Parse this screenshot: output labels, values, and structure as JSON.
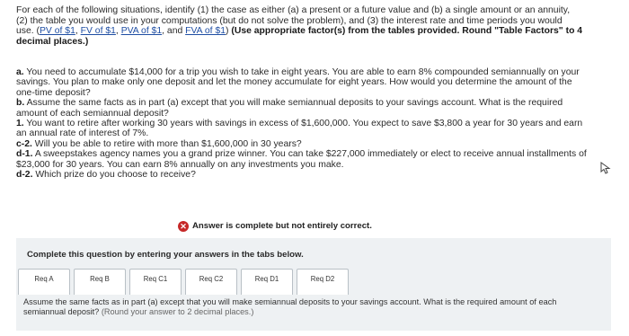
{
  "intro": {
    "line1": "For each of the following situations, identify (1) the case as either (a) a present or a future value and (b) a single amount or an annuity,",
    "line2": "(2) the table you would use in your computations (but do not solve the problem), and (3) the interest rate and time periods you would",
    "use": "use.",
    "link_pv": "PV of $1",
    "link_fv": "FV of $1",
    "link_pva": "PVA of $1",
    "link_fva": "FVA of $1",
    "comma": ", ",
    "and": ", and ",
    "paren_open": "(",
    "paren_close": ")",
    "bold_instruction": "(Use appropriate factor(s) from the tables provided. Round \"Table Factors\" to 4",
    "bold_instruction2": "decimal places.)"
  },
  "questions": [
    {
      "label": "a.",
      "text": "You need to accumulate $14,000 for a trip you wish to take in eight years. You are able to earn 8% compounded semiannually on your savings. You plan to make only one deposit and let the money accumulate for eight years. How would you determine the amount of the one-time deposit?"
    },
    {
      "label": "b.",
      "text": "Assume the same facts as in part (a) except that you will make semiannual deposits to your savings account. What is the required amount of each semiannual deposit?"
    },
    {
      "label": "1.",
      "text": "You want to retire after working 30 years with savings in excess of $1,600,000. You expect to save $3,800 a year for 30 years and earn an annual rate of interest of 7%."
    },
    {
      "label": "c-2.",
      "text": "Will you be able to retire with more than $1,600,000 in 30 years?"
    },
    {
      "label": "d-1.",
      "text": "A sweepstakes agency names you a grand prize winner. You can take $227,000 immediately or elect to receive annual installments of $23,000 for 30 years. You can earn 8% annually on any investments you make."
    },
    {
      "label": "d-2.",
      "text": "Which prize do you choose to receive?"
    }
  ],
  "alert": {
    "icon": "x-circle-icon",
    "message": "Answer is complete but not entirely correct.",
    "color": "#c62828"
  },
  "panel": {
    "instruction": "Complete this question by entering your answers in the tabs below.",
    "tabs": [
      "Req A",
      "Req B",
      "Req C1",
      "Req C2",
      "Req D1",
      "Req D2"
    ],
    "content_main": "Assume the same facts as in part (a) except that you will make semiannual deposits to your savings account. What is the required amount of each semiannual deposit?",
    "content_grey": "(Round your answer to 2 decimal places.)"
  }
}
